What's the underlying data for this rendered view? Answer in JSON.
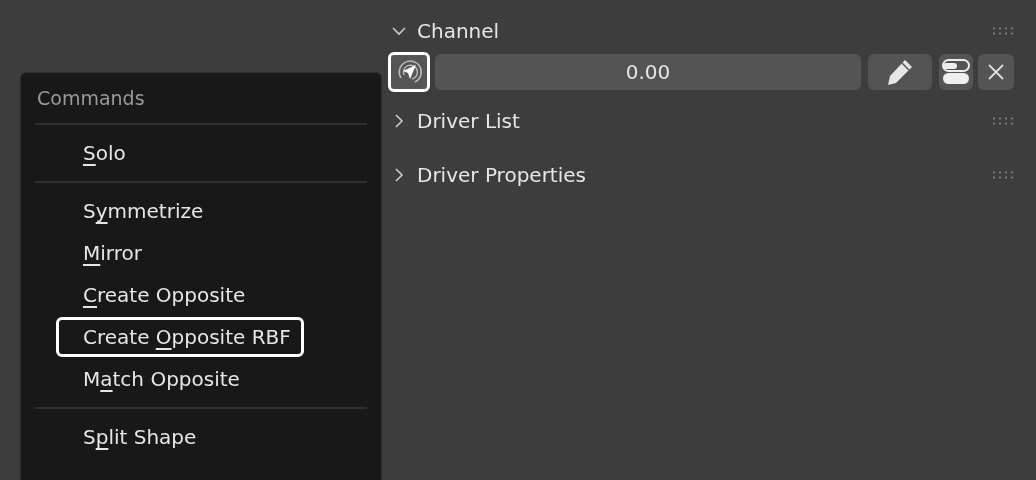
{
  "menu": {
    "title": "Commands",
    "groups": [
      [
        {
          "key": "S",
          "after": "olo",
          "selected": false
        }
      ],
      [
        {
          "before": "S",
          "key": "y",
          "after": "mmetrize",
          "selected": false
        },
        {
          "key": "M",
          "after": "irror",
          "selected": false
        },
        {
          "key": "C",
          "after": "reate Opposite",
          "selected": false
        },
        {
          "before": "Create ",
          "key": "O",
          "after": "pposite RBF",
          "selected": true
        },
        {
          "before": "M",
          "key": "a",
          "after": "tch Opposite",
          "selected": false
        }
      ],
      [
        {
          "before": "S",
          "key": "p",
          "after": "lit Shape",
          "selected": false
        }
      ]
    ]
  },
  "panels": [
    {
      "title": "Channel",
      "expanded": true
    },
    {
      "title": "Driver List",
      "expanded": false
    },
    {
      "title": "Driver Properties",
      "expanded": false
    }
  ],
  "channel_row": {
    "value": "0.00",
    "target_selected": true
  }
}
